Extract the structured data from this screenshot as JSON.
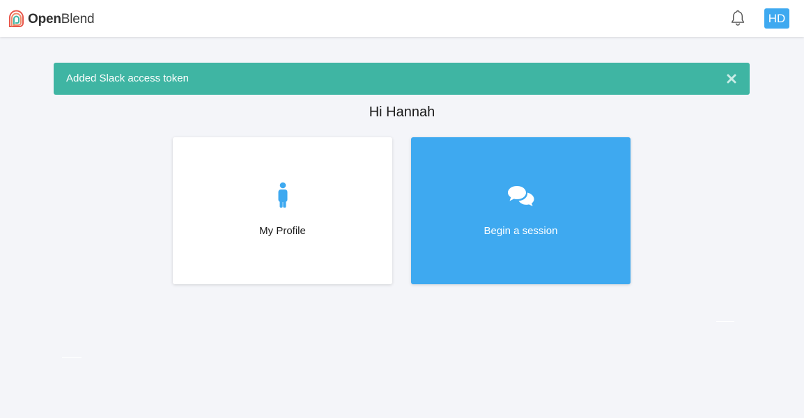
{
  "app": {
    "name_part1": "Open",
    "name_part2": "Blend"
  },
  "header": {
    "notifications_icon": "bell-icon",
    "avatar_initials": "HD",
    "accent_color": "#3ea9f0"
  },
  "alert": {
    "message": "Added Slack access token",
    "color": "#3fb5a3",
    "close_icon": "close-icon"
  },
  "greeting": "Hi Hannah",
  "cards": [
    {
      "label": "My Profile",
      "icon": "person-icon",
      "background": "#ffffff"
    },
    {
      "label": "Begin a session",
      "icon": "chat-bubbles-icon",
      "background": "#3ea9f0"
    }
  ]
}
